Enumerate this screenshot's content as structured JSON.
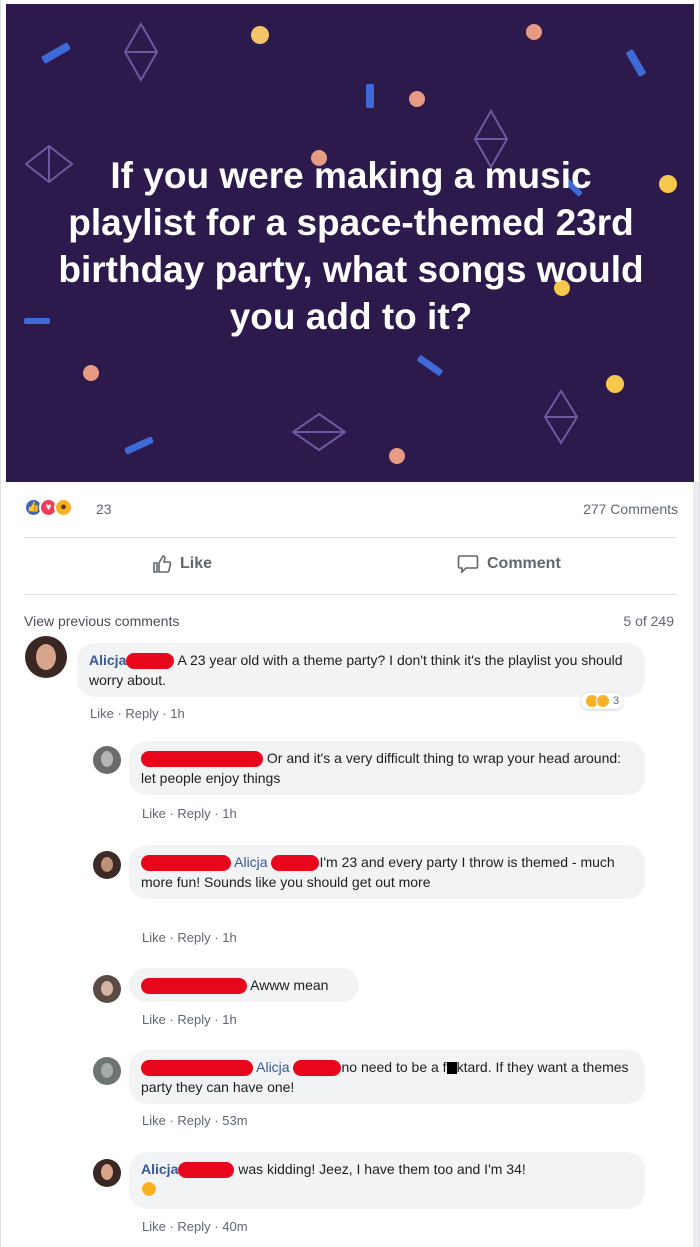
{
  "post": {
    "question": "If you were making a music playlist for a space-themed 23rd birthday party, what songs would you add to it?",
    "reactions": {
      "icons": [
        "like-icon",
        "love-icon",
        "wow-icon"
      ],
      "count": "23"
    },
    "comments_count": "277 Comments",
    "like_label": "Like",
    "comment_label": "Comment",
    "colors": {
      "banner": "#2c1a4d",
      "accent": "#385898",
      "redaction": "#e8061c"
    }
  },
  "comments_header": {
    "view_previous": "View previous comments",
    "page_count": "5 of 249"
  },
  "comments": [
    {
      "name": "Alicja",
      "text": "A 23 year old with a theme party? I don't think it's the playlist you should worry about.",
      "like": "Like",
      "reply": "Reply",
      "time": "1h",
      "reaction_count": "3"
    },
    {
      "name": "",
      "text": "Or and it's a very difficult thing to wrap your head around: let people enjoy things",
      "like": "Like",
      "reply": "Reply",
      "time": "1h"
    },
    {
      "name": "",
      "mention": "Alicja",
      "text": "I'm 23 and every party I throw is themed - much more fun! Sounds like you should get out more",
      "like": "Like",
      "reply": "Reply",
      "time": "1h"
    },
    {
      "name": "",
      "text": "Awww mean",
      "like": "Like",
      "reply": "Reply",
      "time": "1h"
    },
    {
      "name": "",
      "mention": "Alicja",
      "text_a": "no need to be a f",
      "text_b": "ktard. If they want a themes party they can have one!",
      "like": "Like",
      "reply": "Reply",
      "time": "53m"
    },
    {
      "name": "Alicja",
      "text": "was kidding! Jeez, I have them too and I'm 34!",
      "like": "Like",
      "reply": "Reply",
      "time": "40m"
    }
  ]
}
